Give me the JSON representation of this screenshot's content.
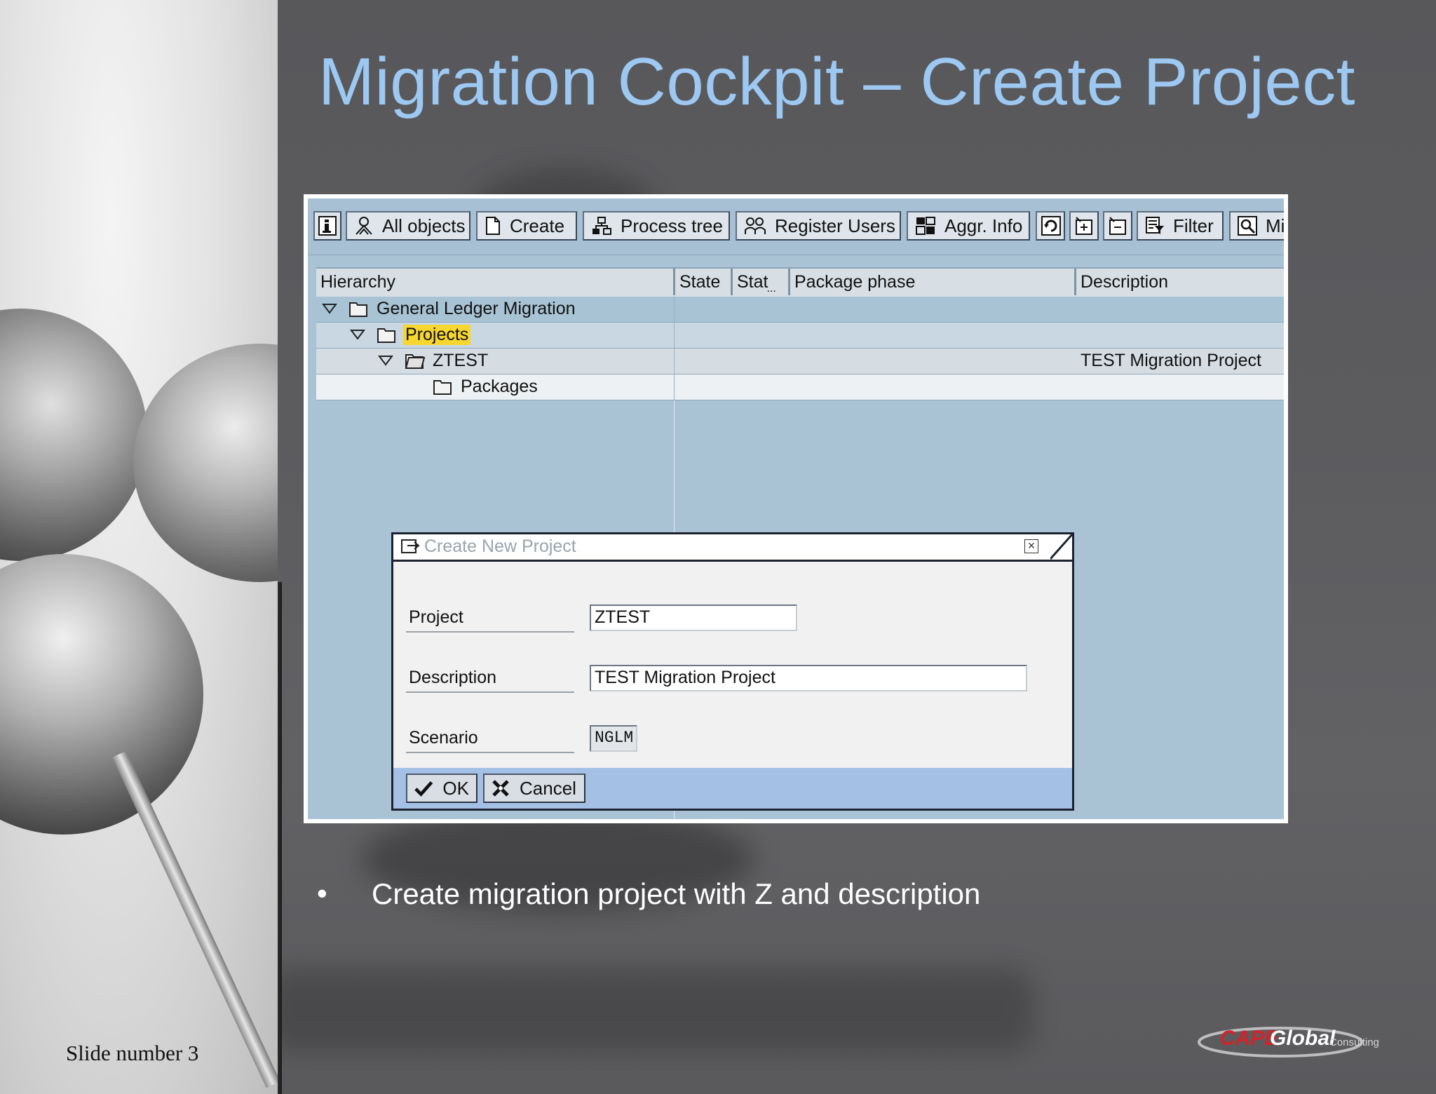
{
  "slide": {
    "title": "Migration Cockpit – Create Project",
    "bullet_symbol": "•",
    "bullet_text": "Create migration project with Z and description",
    "slide_number": "Slide number 3"
  },
  "logo": {
    "part1": "CAPE",
    "part2": "Global",
    "part3": "Consulting"
  },
  "toolbar": {
    "info_icon_label": "",
    "all_objects": "All objects",
    "create": "Create",
    "process_tree": "Process tree",
    "register_users": "Register Users",
    "aggr_info": "Aggr. Info",
    "filter": "Filter",
    "more": "Mi"
  },
  "table": {
    "headers": {
      "hierarchy": "Hierarchy",
      "state": "State",
      "stat": "Stat",
      "stat_ellipsis": "...",
      "package_phase": "Package phase",
      "description": "Description"
    },
    "rows": [
      {
        "label": "General Ledger Migration",
        "description": ""
      },
      {
        "label": "Projects",
        "description": ""
      },
      {
        "label": "ZTEST",
        "description": "TEST Migration Project"
      },
      {
        "label": "Packages",
        "description": ""
      }
    ]
  },
  "dialog": {
    "title": "Create New Project",
    "close_symbol": "×",
    "fields": {
      "project_label": "Project",
      "project_value": "ZTEST",
      "description_label": "Description",
      "description_value": "TEST Migration Project",
      "scenario_label": "Scenario",
      "scenario_value": "NGLM"
    },
    "ok_label": "OK",
    "cancel_label": "Cancel"
  },
  "colors": {
    "title": "#9cc8f2",
    "sap_background": "#a9c3d5",
    "highlight": "#f7d630",
    "dialog_footer": "#a4c1e5",
    "logo_red": "#d3222a"
  },
  "icons": [
    "info-icon",
    "user-icon",
    "document-icon",
    "hierarchy-icon",
    "register-users-icon",
    "aggregate-icon",
    "refresh-icon",
    "expand-icon",
    "collapse-icon",
    "filter-icon",
    "search-icon",
    "triangle-down-icon",
    "folder-icon",
    "checkmark-icon",
    "cancel-x-icon"
  ]
}
